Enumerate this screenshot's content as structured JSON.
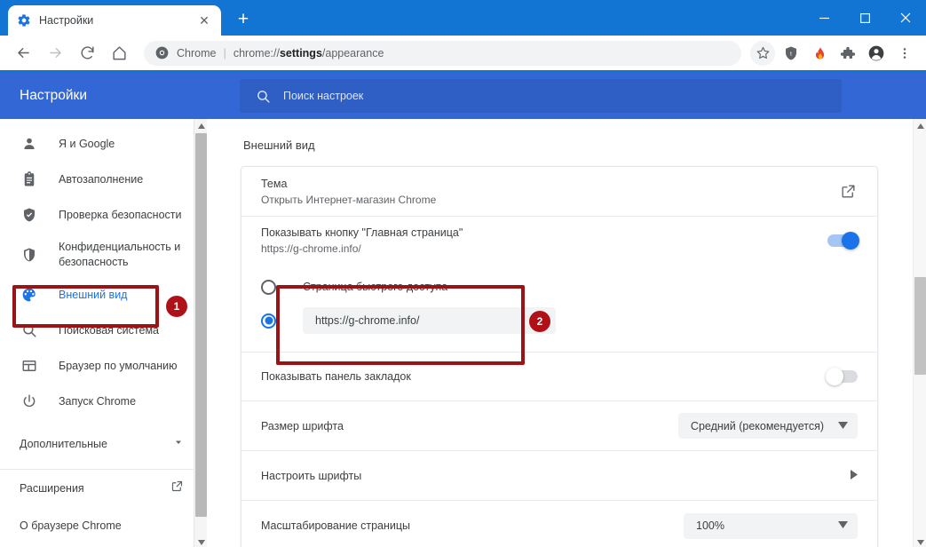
{
  "window": {
    "controls": {
      "minimize": "—",
      "maximize": "□",
      "close": "✕"
    }
  },
  "tabstrip": {
    "tab": {
      "title": "Настройки",
      "favicon": "gear-icon",
      "close": "✕"
    },
    "new_tab": "+"
  },
  "toolbar": {
    "back": "←",
    "forward": "→",
    "reload": "⟳",
    "home": "⌂",
    "omnibox": {
      "chip": "Chrome",
      "separator": "|",
      "url_prefix": "chrome://",
      "url_bold": "settings",
      "url_suffix": "/appearance",
      "full_url": "chrome://settings/appearance"
    },
    "icons": [
      {
        "name": "bookmark-star-icon",
        "glyph": "☆"
      },
      {
        "name": "shield-extension-icon",
        "glyph": "🛡"
      },
      {
        "name": "flame-extension-icon",
        "glyph": "🔥"
      },
      {
        "name": "puzzle-extensions-icon",
        "glyph": "🧩"
      },
      {
        "name": "profile-avatar-icon",
        "glyph": "👤"
      },
      {
        "name": "more-menu-icon",
        "glyph": "⋮"
      }
    ]
  },
  "settings_header": {
    "title": "Настройки",
    "search_placeholder": "Поиск настроек",
    "search_value": "",
    "bg_color": "#3367d6"
  },
  "sidebar": {
    "items": [
      {
        "label": "Я и Google",
        "icon": "person-icon",
        "active": false
      },
      {
        "label": "Автозаполнение",
        "icon": "clipboard-icon",
        "active": false
      },
      {
        "label": "Проверка безопасности",
        "icon": "shield-check-icon",
        "active": false
      },
      {
        "label": "Конфиденциальность и безопасность",
        "icon": "shield-icon",
        "active": false
      },
      {
        "label": "Внешний вид",
        "icon": "palette-icon",
        "active": true
      },
      {
        "label": "Поисковая система",
        "icon": "search-icon",
        "active": false
      },
      {
        "label": "Браузер по умолчанию",
        "icon": "browser-window-icon",
        "active": false
      },
      {
        "label": "Запуск Chrome",
        "icon": "power-icon",
        "active": false
      }
    ],
    "expand": {
      "label": "Дополнительные",
      "icon": "chevron-down-icon"
    },
    "links": [
      {
        "label": "Расширения",
        "icon": "external-link-icon"
      },
      {
        "label": "О браузере Chrome",
        "icon": ""
      }
    ]
  },
  "main": {
    "section_title": "Внешний вид",
    "rows": {
      "theme": {
        "title": "Тема",
        "subtitle": "Открыть Интернет-магазин Chrome",
        "action_icon": "external-link-icon"
      },
      "home_button": {
        "title": "Показывать кнопку \"Главная страница\"",
        "subtitle": "https://g-chrome.info/",
        "toggle_state": "on"
      },
      "homepage_options": {
        "option_ntp": {
          "label": "Страница быстрого доступа",
          "selected": false
        },
        "option_url": {
          "label": "",
          "selected": true,
          "input_value": "https://g-chrome.info/"
        }
      },
      "bookmarks_bar": {
        "title": "Показывать панель закладок",
        "toggle_state": "off"
      },
      "font_size": {
        "title": "Размер шрифта",
        "value": "Средний (рекомендуется)",
        "caret": "▼"
      },
      "customize_fonts": {
        "title": "Настроить шрифты",
        "chevron": "▶"
      },
      "page_zoom": {
        "title": "Масштабирование страницы",
        "value": "100%",
        "caret": "▼"
      }
    }
  },
  "annotations": {
    "badge_1": "1",
    "badge_2": "2",
    "highlight_color": "#9c1316",
    "badge_color": "#b01116"
  },
  "scrollbars": {
    "sidebar": {
      "up": "▲",
      "down": "▼"
    },
    "main": {
      "up": "▲",
      "down": "▼"
    }
  }
}
